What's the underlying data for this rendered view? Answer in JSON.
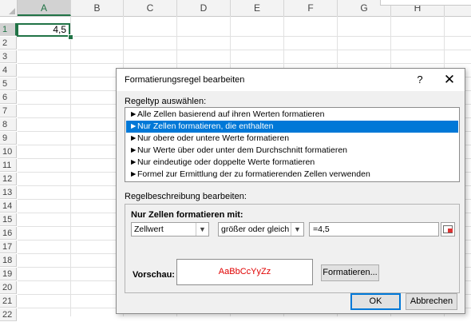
{
  "sheet": {
    "columns": [
      "A",
      "B",
      "C",
      "D",
      "E",
      "F",
      "G",
      "H"
    ],
    "selected_column": "A",
    "rows": [
      "1",
      "2",
      "3",
      "4",
      "5",
      "6",
      "7",
      "8",
      "9",
      "10",
      "11",
      "12",
      "13",
      "14",
      "15",
      "16",
      "17",
      "18",
      "19",
      "20",
      "21",
      "22"
    ],
    "selected_row": "1",
    "cell_a1_value": "4,5"
  },
  "dialog": {
    "title": "Formatierungsregel bearbeiten",
    "help_label": "?",
    "close_label": "✕",
    "rule_type_label": "Regeltyp auswählen:",
    "rule_types": [
      "Alle Zellen basierend auf ihren Werten formatieren",
      "Nur Zellen formatieren, die enthalten",
      "Nur obere oder untere Werte formatieren",
      "Nur Werte über oder unter dem Durchschnitt formatieren",
      "Nur eindeutige oder doppelte Werte formatieren",
      "Formel zur Ermittlung der zu formatierenden Zellen verwenden"
    ],
    "selected_rule_index": 1,
    "arrow_glyph": "►",
    "description_label": "Regelbeschreibung bearbeiten:",
    "format_only_label": "Nur Zellen formatieren mit:",
    "condition_type": "Zellwert",
    "operator": "größer oder gleich",
    "value": "=4,5",
    "preview_label": "Vorschau:",
    "preview_text": "AaBbCcYyZz",
    "preview_color": "#e00000",
    "format_button": "Formatieren...",
    "ok_button": "OK",
    "cancel_button": "Abbrechen",
    "accent_color": "#0078d7",
    "grid_accent_color": "#217346",
    "dropdown_icon": "chevron-down-icon",
    "range_picker_icon": "range-picker-icon"
  }
}
